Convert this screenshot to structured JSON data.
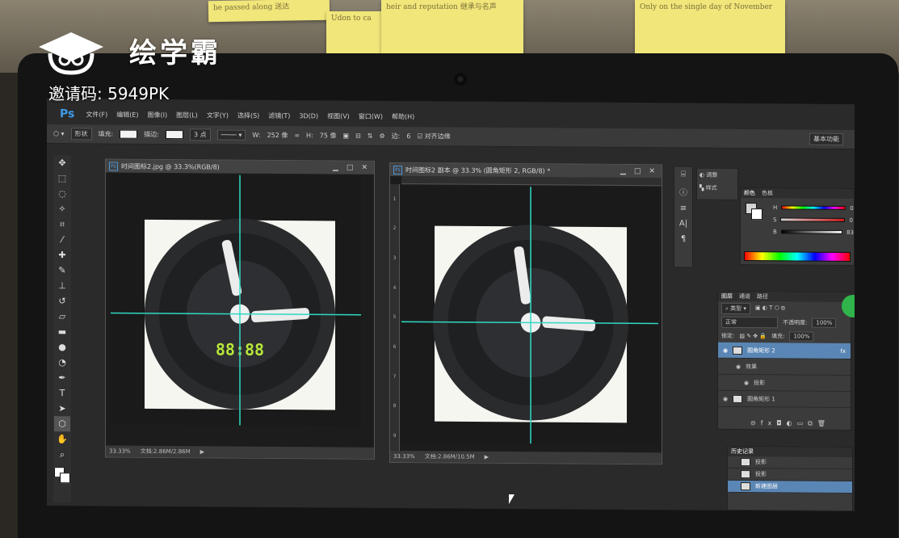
{
  "sticky_notes": [
    "be passed along 送达",
    "Udon to ca",
    "heir and reputation 继承与名声",
    "Only on the single day of November"
  ],
  "watermark": {
    "brand": "绘学霸",
    "invite_code": "邀请码: 5949PK"
  },
  "photoshop": {
    "app_logo": "Ps",
    "menu": [
      "文件(F)",
      "编辑(E)",
      "图像(I)",
      "图层(L)",
      "文字(Y)",
      "选择(S)",
      "滤镜(T)",
      "3D(D)",
      "视图(V)",
      "窗口(W)",
      "帮助(H)"
    ],
    "options_bar": {
      "mode": "形状",
      "fill_label": "填充:",
      "stroke_label": "描边:",
      "stroke_width": "3 点",
      "w_label": "W:",
      "w_value": "252 像",
      "h_label": "H:",
      "h_value": "75 像",
      "sides_label": "边:",
      "sides_value": "6",
      "align_edges": "对齐边缘",
      "workspace": "基本功能"
    },
    "doc1": {
      "title": "时间图标2.jpg @ 33.3%(RGB/8)",
      "zoom": "33.33%",
      "status": "文档:2.86M/2.86M",
      "digital_time": "88:88"
    },
    "doc2": {
      "title": "时间图标2 副本 @ 33.3% (圆角矩形 2, RGB/8) *",
      "zoom": "33.33%",
      "status": "文档:2.86M/10.5M"
    },
    "adjust_panel": {
      "items": [
        "调整",
        "样式"
      ]
    },
    "color_panel": {
      "tabs": [
        "颜色",
        "色板"
      ],
      "h_label": "H",
      "h_value": "0",
      "s_label": "S",
      "s_value": "0",
      "b_label": "B",
      "b_value": "83"
    },
    "layers_panel": {
      "tabs": [
        "图层",
        "通道",
        "路径"
      ],
      "kind": "类型",
      "blend": "正常",
      "opacity_label": "不透明度:",
      "opacity_value": "100%",
      "lock_label": "锁定:",
      "fill_label": "填充:",
      "fill_value": "100%",
      "layers": [
        {
          "name": "圆角矩形 2",
          "selected": true
        },
        {
          "name": "效果",
          "selected": false
        },
        {
          "name": "投影",
          "selected": false
        },
        {
          "name": "圆角矩形 1",
          "selected": false
        }
      ]
    },
    "history_panel": {
      "title": "历史记录",
      "items": [
        "投影",
        "投影",
        "新建图层"
      ]
    }
  },
  "colors": {
    "guide": "#2fd9c4",
    "digital": "#b7e83a",
    "ps_blue": "#3d9ae8"
  }
}
